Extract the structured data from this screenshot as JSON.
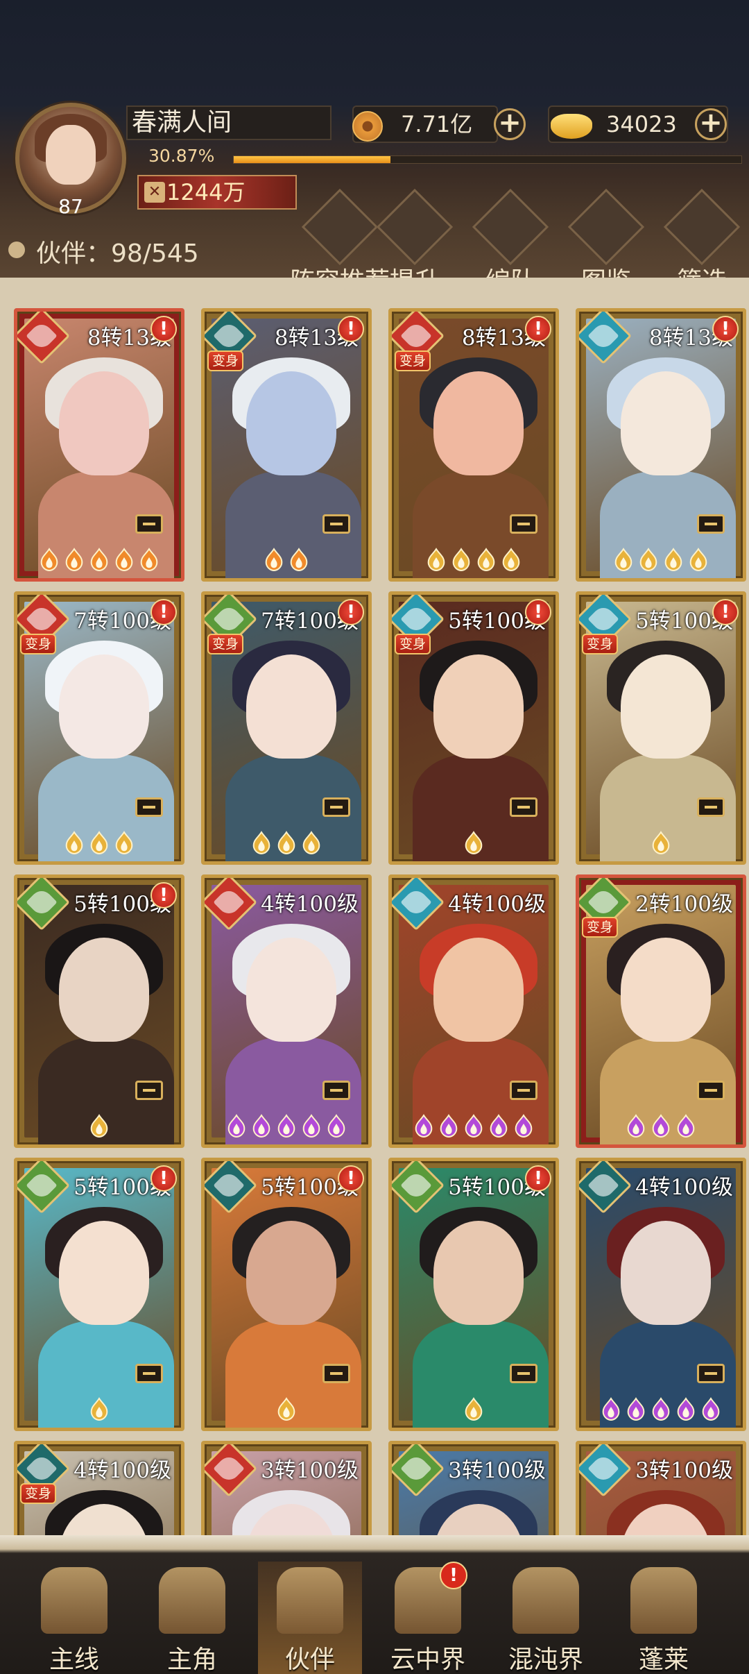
{
  "player": {
    "name": "春满人间",
    "level": "87",
    "exp_text": "30.87%",
    "exp_progress": 0.3087,
    "power": "1244万"
  },
  "resources": [
    {
      "icon": "coin-icon",
      "value": "7.71亿"
    },
    {
      "icon": "gold-ingot-icon",
      "value": "34023"
    }
  ],
  "partners": {
    "label": "伙伴：",
    "count": "98/545"
  },
  "menu": [
    {
      "label": "阵容推荐",
      "icon": "lineup-recommend-icon"
    },
    {
      "label": "提升",
      "icon": "upgrade-icon"
    },
    {
      "label": "编队",
      "icon": "formation-icon"
    },
    {
      "label": "图鉴",
      "icon": "codex-icon"
    },
    {
      "label": "筛选",
      "icon": "filter-icon"
    }
  ],
  "badges": {
    "alert": "!",
    "transform": "变身"
  },
  "cards": [
    {
      "level": "8转13级",
      "element": "fire",
      "alert": true,
      "transform": false,
      "flames": 5,
      "flame_color": "orange",
      "red": true,
      "art": [
        "#c8866e",
        "#e8e2dc",
        "#f0c8c0"
      ]
    },
    {
      "level": "8转13级",
      "element": "shadow",
      "alert": true,
      "transform": true,
      "flames": 2,
      "flame_color": "orange",
      "red": false,
      "art": [
        "#5b5e72",
        "#e8ecf0",
        "#b6c6e4"
      ]
    },
    {
      "level": "8转13级",
      "element": "fire",
      "alert": true,
      "transform": true,
      "flames": 4,
      "flame_color": "gold",
      "red": false,
      "art": [
        "#7a4a2a",
        "#2a2a30",
        "#f0b8a0"
      ]
    },
    {
      "level": "8转13级",
      "element": "water",
      "alert": true,
      "transform": false,
      "flames": 4,
      "flame_color": "gold",
      "red": false,
      "art": [
        "#9ab0c0",
        "#c8d8e8",
        "#f4e8dc"
      ]
    },
    {
      "level": "7转100级",
      "element": "fire",
      "alert": true,
      "transform": true,
      "flames": 3,
      "flame_color": "gold",
      "red": false,
      "art": [
        "#9ab8c8",
        "#f0f4f8",
        "#f4e8e4"
      ]
    },
    {
      "level": "7转100级",
      "element": "wood",
      "alert": true,
      "transform": true,
      "flames": 3,
      "flame_color": "gold",
      "red": false,
      "art": [
        "#3e5a6a",
        "#2a2a40",
        "#f4e0d4"
      ]
    },
    {
      "level": "5转100级",
      "element": "water",
      "alert": true,
      "transform": true,
      "flames": 1,
      "flame_color": "gold",
      "red": false,
      "art": [
        "#5a2a20",
        "#1e1a1a",
        "#f0d0b8"
      ]
    },
    {
      "level": "5转100级",
      "element": "water",
      "alert": true,
      "transform": true,
      "flames": 1,
      "flame_color": "gold",
      "red": false,
      "art": [
        "#c8b890",
        "#2a2422",
        "#f4e6d4"
      ]
    },
    {
      "level": "5转100级",
      "element": "wood",
      "alert": true,
      "transform": false,
      "flames": 1,
      "flame_color": "gold",
      "red": false,
      "art": [
        "#3a2a22",
        "#1a1616",
        "#e8d4c4"
      ]
    },
    {
      "level": "4转100级",
      "element": "fire",
      "alert": false,
      "transform": false,
      "flames": 5,
      "flame_color": "purple",
      "red": false,
      "art": [
        "#8a5aa0",
        "#e8e8ec",
        "#f4e4dc"
      ]
    },
    {
      "level": "4转100级",
      "element": "water",
      "alert": false,
      "transform": false,
      "flames": 5,
      "flame_color": "purple",
      "red": false,
      "art": [
        "#a0442a",
        "#c83c28",
        "#f0c4a4"
      ]
    },
    {
      "level": "2转100级",
      "element": "wood",
      "alert": false,
      "transform": true,
      "flames": 3,
      "flame_color": "purple",
      "red": true,
      "art": [
        "#c8a060",
        "#2a2020",
        "#f4dcc8"
      ]
    },
    {
      "level": "5转100级",
      "element": "wood",
      "alert": true,
      "transform": false,
      "flames": 1,
      "flame_color": "gold",
      "red": false,
      "art": [
        "#58b8c8",
        "#2a2020",
        "#f4e0d0"
      ]
    },
    {
      "level": "5转100级",
      "element": "shadow",
      "alert": true,
      "transform": false,
      "flames": 1,
      "flame_color": "gold",
      "red": false,
      "art": [
        "#d87a3a",
        "#242020",
        "#d8a890"
      ]
    },
    {
      "level": "5转100级",
      "element": "wood",
      "alert": true,
      "transform": false,
      "flames": 1,
      "flame_color": "gold",
      "red": false,
      "art": [
        "#2a8a6a",
        "#201c1c",
        "#e8c8b0"
      ]
    },
    {
      "level": "4转100级",
      "element": "shadow",
      "alert": false,
      "transform": false,
      "flames": 5,
      "flame_color": "purple",
      "red": false,
      "art": [
        "#2a4a6a",
        "#6a2020",
        "#e8d8d0"
      ]
    },
    {
      "level": "4转100级",
      "element": "shadow",
      "alert": false,
      "transform": true,
      "flames": 0,
      "flame_color": "gold",
      "red": false,
      "art": [
        "#c8c0b0",
        "#1c1818",
        "#f0e0d0"
      ]
    },
    {
      "level": "3转100级",
      "element": "fire",
      "alert": false,
      "transform": false,
      "flames": 0,
      "flame_color": "gold",
      "red": false,
      "art": [
        "#c8a0a8",
        "#e8e4e8",
        "#f0dcd8"
      ]
    },
    {
      "level": "3转100级",
      "element": "wood",
      "alert": false,
      "transform": false,
      "flames": 0,
      "flame_color": "gold",
      "red": false,
      "art": [
        "#4a7aa8",
        "#2a3a5a",
        "#e8d0c0"
      ]
    },
    {
      "level": "3转100级",
      "element": "water",
      "alert": false,
      "transform": false,
      "flames": 0,
      "flame_color": "gold",
      "red": false,
      "art": [
        "#a85a40",
        "#8a3020",
        "#f0d0c0"
      ]
    }
  ],
  "element_colors": {
    "fire": "#c8342a",
    "shadow": "#1f6a6a",
    "water": "#2a9ab0",
    "wood": "#5a9a3a"
  },
  "flame_colors": {
    "orange": "#f08a2a",
    "gold": "#e8b23a",
    "purple": "#b24ad8"
  },
  "nav": [
    {
      "label": "主线",
      "icon": "crossed-swords-icon",
      "alert": false,
      "active": false
    },
    {
      "label": "主角",
      "icon": "hero-icon",
      "alert": false,
      "active": false
    },
    {
      "label": "伙伴",
      "icon": "partner-icon",
      "alert": false,
      "active": true
    },
    {
      "label": "云中界",
      "icon": "cloud-realm-icon",
      "alert": true,
      "active": false
    },
    {
      "label": "混沌界",
      "icon": "chaos-realm-icon",
      "alert": false,
      "active": false
    },
    {
      "label": "蓬莱",
      "icon": "penglai-icon",
      "alert": false,
      "active": false
    }
  ]
}
